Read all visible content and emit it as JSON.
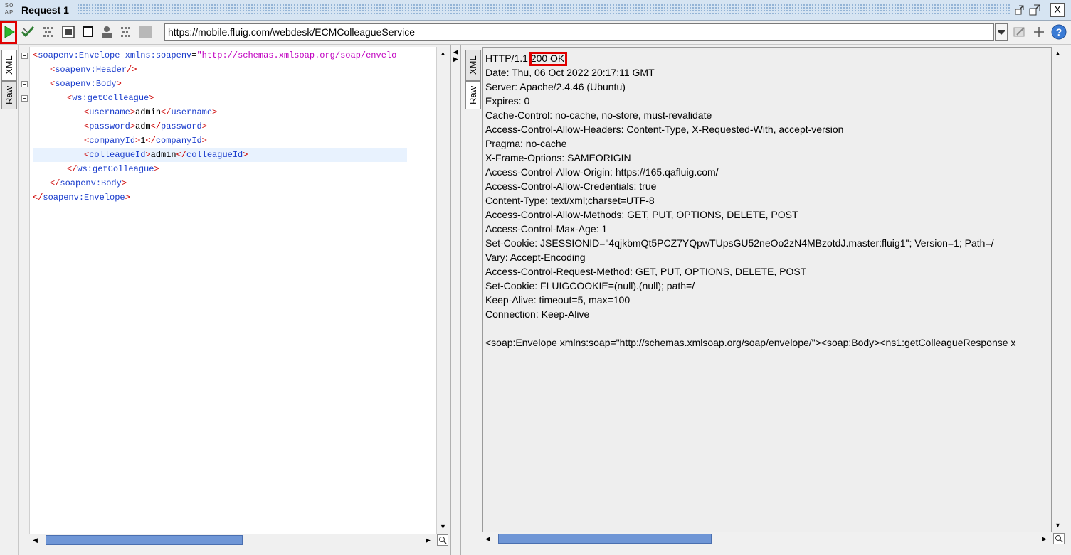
{
  "window": {
    "icon_text": "SO\nAP",
    "title": "Request 1",
    "close_label": "X"
  },
  "toolbar": {
    "endpoint_url": "https://mobile.fluig.com/webdesk/ECMColleagueService",
    "icons": [
      "run-icon",
      "validate-icon",
      "wsa-icon",
      "editor-icon",
      "checkbox-icon",
      "user-icon",
      "wss-icon",
      "stop-icon",
      "dropdown-icon",
      "edit-endpoint-icon",
      "add-icon",
      "help-icon"
    ],
    "accent_color": "#e00000"
  },
  "request": {
    "tabs": [
      "XML",
      "Raw"
    ],
    "lines": [
      {
        "open": "<",
        "name": "soapenv:Envelope",
        "attr": " xmlns:soapenv",
        "eq": "=",
        "value": "\"http://schemas.xmlsoap.org/soap/envelo"
      },
      {
        "open": "<",
        "name": "soapenv:Header",
        "close": "/>"
      },
      {
        "open": "<",
        "name": "soapenv:Body",
        "close": ">"
      },
      {
        "open": "<",
        "name": "ws:getColleague",
        "close": ">"
      },
      {
        "open": "<",
        "name": "username",
        "close": ">",
        "text": "admin",
        "endopen": "</",
        "endname": "username",
        "endclose": ">"
      },
      {
        "open": "<",
        "name": "password",
        "close": ">",
        "text": "adm",
        "endopen": "</",
        "endname": "password",
        "endclose": ">"
      },
      {
        "open": "<",
        "name": "companyId",
        "close": ">",
        "text": "1",
        "endopen": "</",
        "endname": "companyId",
        "endclose": ">"
      },
      {
        "open": "<",
        "name": "colleagueId",
        "close": ">",
        "text": "admin",
        "endopen": "</",
        "endname": "colleagueId",
        "endclose": ">"
      },
      {
        "open": "</",
        "name": "ws:getColleague",
        "close": ">"
      },
      {
        "open": "</",
        "name": "soapenv:Body",
        "close": ">"
      },
      {
        "open": "</",
        "name": "soapenv:Envelope",
        "close": ">"
      }
    ]
  },
  "response": {
    "tabs": [
      "XML",
      "Raw"
    ],
    "status_prefix": "HTTP/1.1 ",
    "status": "200 OK",
    "headers": [
      "Date: Thu, 06 Oct 2022 20:17:11 GMT",
      "Server: Apache/2.4.46 (Ubuntu)",
      "Expires: 0",
      "Cache-Control: no-cache, no-store, must-revalidate",
      "Access-Control-Allow-Headers: Content-Type, X-Requested-With, accept-version",
      "Pragma: no-cache",
      "X-Frame-Options: SAMEORIGIN",
      "Access-Control-Allow-Origin: https://165.qafluig.com/",
      "Access-Control-Allow-Credentials: true",
      "Content-Type: text/xml;charset=UTF-8",
      "Access-Control-Allow-Methods: GET, PUT, OPTIONS, DELETE, POST",
      "Access-Control-Max-Age: 1",
      "Set-Cookie: JSESSIONID=\"4qjkbmQt5PCZ7YQpwTUpsGU52neOo2zN4MBzotdJ.master:fluig1\"; Version=1; Path=/",
      "Vary: Accept-Encoding",
      "Access-Control-Request-Method: GET, PUT, OPTIONS, DELETE, POST",
      "Set-Cookie: FLUIGCOOKIE=(null).(null); path=/",
      "Keep-Alive: timeout=5, max=100",
      "Connection: Keep-Alive"
    ],
    "body": "<soap:Envelope xmlns:soap=\"http://schemas.xmlsoap.org/soap/envelope/\"><soap:Body><ns1:getColleagueResponse x"
  }
}
